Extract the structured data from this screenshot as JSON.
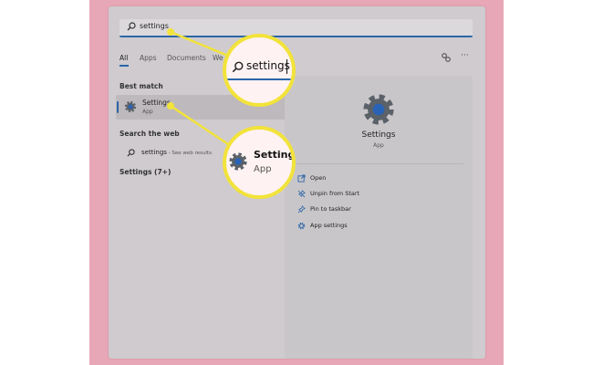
{
  "search": {
    "query": "settings"
  },
  "tabs": [
    {
      "label": "All"
    },
    {
      "label": "Apps"
    },
    {
      "label": "Documents"
    },
    {
      "label": "We"
    }
  ],
  "best_match": {
    "heading": "Best match",
    "title": "Settings",
    "subtitle": "App"
  },
  "web": {
    "heading": "Search the web",
    "query": "settings",
    "hint": " - See web results"
  },
  "settings_count": "Settings (7+)",
  "detail": {
    "title": "Settings",
    "subtitle": "App",
    "actions": [
      {
        "label": "Open",
        "icon": "open-icon"
      },
      {
        "label": "Unpin from Start",
        "icon": "unpin-icon"
      },
      {
        "label": "Pin to taskbar",
        "icon": "pin-icon"
      },
      {
        "label": "App settings",
        "icon": "gear-icon"
      }
    ]
  },
  "callouts": {
    "search_text": "settings",
    "app_title": "Settings",
    "app_subtitle": "App"
  },
  "colors": {
    "accent": "#2b66a8",
    "highlight": "#f2e33a",
    "background": "#e8a7b7"
  }
}
